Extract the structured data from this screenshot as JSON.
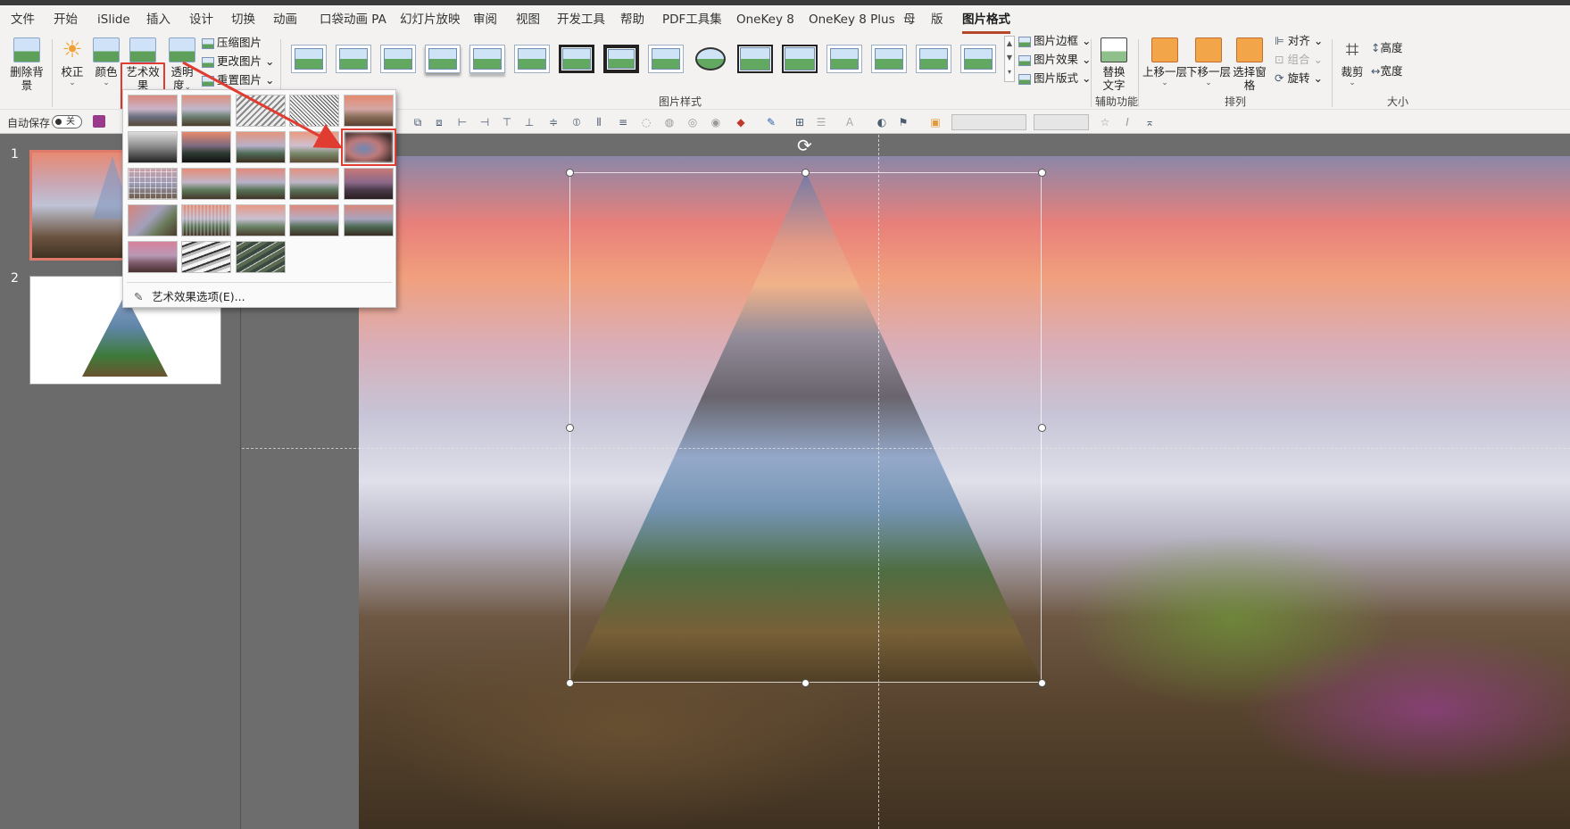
{
  "menu": {
    "tabs": [
      "文件",
      "开始",
      "iSlide",
      "插入",
      "设计",
      "切换",
      "动画",
      "口袋动画 PA",
      "幻灯片放映",
      "审阅",
      "视图",
      "开发工具",
      "帮助",
      "PDF工具集",
      "OneKey 8",
      "OneKey 8 Plus",
      "母",
      "版",
      "图片格式"
    ],
    "active_tab": "图片格式"
  },
  "ribbon": {
    "remove_bg": "删除背景",
    "correct": "校正",
    "color": "颜色",
    "art_effects": "艺术效果",
    "transparency_line1": "透明",
    "transparency_line2": "度",
    "compress": "压缩图片",
    "change_picture": "更改图片",
    "reset_picture": "重置图片",
    "picture_styles_group": "图片样式",
    "picture_border": "图片边框",
    "picture_effects": "图片效果",
    "picture_layout": "图片版式",
    "alt_text_line1": "替换",
    "alt_text_line2": "文字",
    "accessibility_group": "辅助功能",
    "bring_forward": "上移一层",
    "send_backward": "下移一层",
    "selection_pane": "选择窗格",
    "align": "对齐",
    "group": "组合",
    "rotate": "旋转",
    "arrange_group": "排列",
    "crop": "裁剪",
    "height_label": "高度",
    "width_label": "宽度",
    "size_group": "大小"
  },
  "qat": {
    "autosave": "自动保存",
    "toggle_state": "关"
  },
  "slides": {
    "numbers": [
      "1",
      "2"
    ]
  },
  "art_dropdown": {
    "options_label": "艺术效果选项(E)..."
  },
  "colors": {
    "accent": "#b7472a",
    "highlight_red": "#e03c31"
  }
}
